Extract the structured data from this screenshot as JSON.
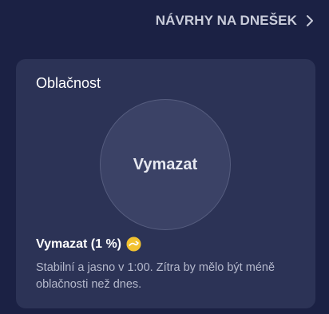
{
  "header": {
    "link_label": "NÁVRHY NA DNEŠEK"
  },
  "card": {
    "title": "Oblačnost",
    "circle_label": "Vymazat",
    "summary": "Vymazat (1 %)",
    "description": "Stabilní a jasno v 1:00. Zítra by mělo být méně oblačnosti než dnes."
  },
  "icons": {
    "link": "chevron-right-icon",
    "trend": "trend-steady-icon"
  },
  "colors": {
    "background": "#1b2144",
    "card": "#2c3356",
    "circle": "#3b4266",
    "trend_icon": "#f2c230"
  }
}
